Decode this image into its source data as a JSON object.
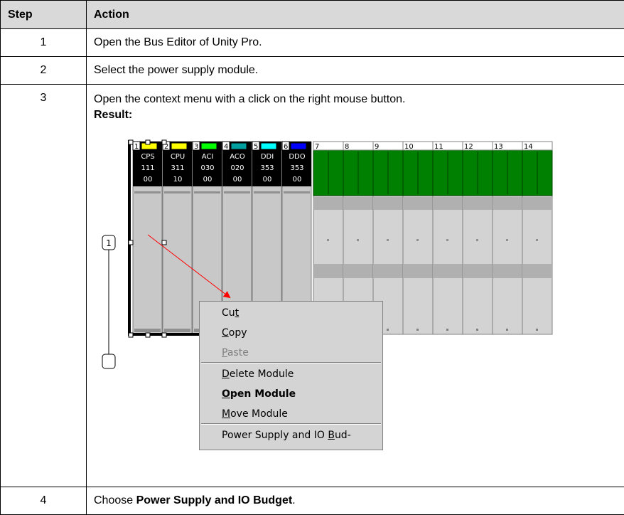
{
  "table": {
    "headers": {
      "step": "Step",
      "action": "Action"
    },
    "rows": [
      {
        "step": "1",
        "action": "Open the Bus Editor of Unity Pro."
      },
      {
        "step": "2",
        "action": "Select the power supply module."
      },
      {
        "step": "3",
        "action": "Open the context menu with a click on the right mouse button.",
        "result_label": "Result:"
      },
      {
        "step": "4",
        "action_prefix": "Choose ",
        "action_bold": "Power Supply and IO Budget",
        "action_suffix": "."
      }
    ]
  },
  "bus_editor": {
    "callout": "1",
    "modules": [
      {
        "slot": "1",
        "line1": "CPS",
        "line2": "111",
        "line3": "00",
        "color": "#ffff00"
      },
      {
        "slot": "2",
        "line1": "CPU",
        "line2": "311",
        "line3": "10",
        "color": "#ffff00"
      },
      {
        "slot": "3",
        "line1": "ACI",
        "line2": "030",
        "line3": "00",
        "color": "#00ff00"
      },
      {
        "slot": "4",
        "line1": "ACO",
        "line2": "020",
        "line3": "00",
        "color": "#00a0a0"
      },
      {
        "slot": "5",
        "line1": "DDI",
        "line2": "353",
        "line3": "00",
        "color": "#00ffff"
      },
      {
        "slot": "6",
        "line1": "DDO",
        "line2": "353",
        "line3": "00",
        "color": "#0000ff"
      }
    ],
    "empty_slots": [
      "7",
      "8",
      "9",
      "10",
      "11",
      "12",
      "13",
      "14"
    ],
    "colors": {
      "empty_slot": "#008000",
      "module_body": "#c8c8c8",
      "arrow": "#ff0000"
    }
  },
  "context_menu": {
    "items": [
      {
        "label": "Cut",
        "mnemonic_index": 2,
        "disabled": false,
        "bold": false
      },
      {
        "label": "Copy",
        "mnemonic_index": 0,
        "disabled": false,
        "bold": false
      },
      {
        "label": "Paste",
        "mnemonic_index": 0,
        "disabled": true,
        "bold": false
      },
      {
        "label": "Delete Module",
        "mnemonic_index": 0,
        "disabled": false,
        "bold": false
      },
      {
        "label": "Open Module",
        "mnemonic_index": 0,
        "disabled": false,
        "bold": true
      },
      {
        "label": "Move Module",
        "mnemonic_index": 0,
        "disabled": false,
        "bold": false
      },
      {
        "label": "Power Supply and IO Bud-",
        "mnemonic_index": 20,
        "disabled": false,
        "bold": false
      }
    ]
  }
}
